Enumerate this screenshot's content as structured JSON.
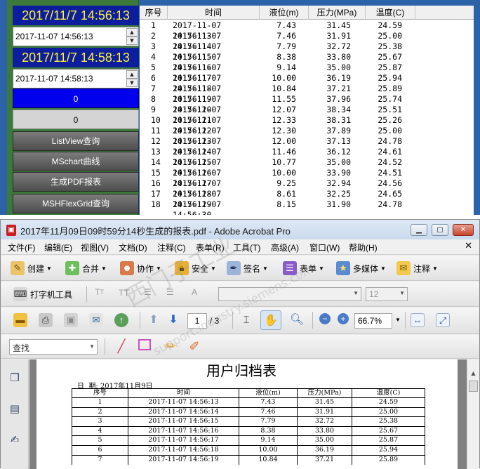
{
  "control_panel": {
    "start_time_display": "2017/11/7 14:56:13",
    "start_time_picker": "2017-11-07 14:56:13",
    "end_time_display": "2017/11/7 14:58:13",
    "end_time_picker": "2017-11-07 14:58:13",
    "counter_1": "0",
    "counter_2": "0",
    "buttons": [
      "ListView查询",
      "MSchart曲线",
      "生成PDF报表",
      "MSHFlexGrid查询"
    ]
  },
  "listview": {
    "columns": [
      "序号",
      "时间",
      "液位(m)",
      "压力(MPa)",
      "温度(C)"
    ],
    "rows": [
      [
        "1",
        "2017-11-07 14:56:13",
        "7.43",
        "31.45",
        "24.59"
      ],
      [
        "2",
        "2017-11-07 14:56:14",
        "7.46",
        "31.91",
        "25.00"
      ],
      [
        "3",
        "2017-11-07 14:56:15",
        "7.79",
        "32.72",
        "25.38"
      ],
      [
        "4",
        "2017-11-07 14:56:16",
        "8.38",
        "33.80",
        "25.67"
      ],
      [
        "5",
        "2017-11-07 14:56:17",
        "9.14",
        "35.00",
        "25.87"
      ],
      [
        "6",
        "2017-11-07 14:56:18",
        "10.00",
        "36.19",
        "25.94"
      ],
      [
        "7",
        "2017-11-07 14:56:19",
        "10.84",
        "37.21",
        "25.89"
      ],
      [
        "8",
        "2017-11-07 14:56:20",
        "11.55",
        "37.96",
        "25.74"
      ],
      [
        "9",
        "2017-11-07 14:56:21",
        "12.07",
        "38.34",
        "25.51"
      ],
      [
        "10",
        "2017-11-07 14:56:22",
        "12.33",
        "38.31",
        "25.26"
      ],
      [
        "11",
        "2017-11-07 14:56:23",
        "12.30",
        "37.89",
        "25.00"
      ],
      [
        "12",
        "2017-11-07 14:56:24",
        "12.00",
        "37.13",
        "24.78"
      ],
      [
        "13",
        "2017-11-07 14:56:25",
        "11.46",
        "36.12",
        "24.61"
      ],
      [
        "14",
        "2017-11-07 14:56:26",
        "10.77",
        "35.00",
        "24.52"
      ],
      [
        "15",
        "2017-11-07 14:56:27",
        "10.00",
        "33.90",
        "24.51"
      ],
      [
        "16",
        "2017-11-07 14:56:28",
        "9.25",
        "32.94",
        "24.56"
      ],
      [
        "17",
        "2017-11-07 14:56:29",
        "8.61",
        "32.25",
        "24.65"
      ],
      [
        "18",
        "2017-11-07 14:56:30",
        "8.15",
        "31.90",
        "24.78"
      ]
    ]
  },
  "acrobat": {
    "title": "2017年11月09日09时59分14秒生成的报表.pdf - Adobe Acrobat Pro",
    "menus": [
      "文件(F)",
      "编辑(E)",
      "视图(V)",
      "文档(D)",
      "注释(C)",
      "表单(R)",
      "工具(T)",
      "高级(A)",
      "窗口(W)",
      "帮助(H)"
    ],
    "toolbar1": [
      "创建",
      "合并",
      "协作",
      "安全",
      "签名",
      "表单",
      "多媒体",
      "注释"
    ],
    "typewriter": "打字机工具",
    "font_size": "12",
    "page_current": "1",
    "page_total": "/ 3",
    "zoom": "66.7%",
    "find_placeholder": "查找"
  },
  "pdf": {
    "title": "用户归档表",
    "date_label": "日  期:",
    "date_value": "2017年11月9日",
    "columns": [
      "序号",
      "时间",
      "液位(m)",
      "压力(MPa)",
      "温度(C)"
    ],
    "rows": [
      [
        "1",
        "2017-11-07  14:56:13",
        "7.43",
        "31.45",
        "24.59"
      ],
      [
        "2",
        "2017-11-07  14:56:14",
        "7.46",
        "31.91",
        "25.00"
      ],
      [
        "3",
        "2017-11-07  14:56:15",
        "7.79",
        "32.72",
        "25.38"
      ],
      [
        "4",
        "2017-11-07  14:56:16",
        "8.38",
        "33.80",
        "25.67"
      ],
      [
        "5",
        "2017-11-07  14:56:17",
        "9.14",
        "35.00",
        "25.87"
      ],
      [
        "6",
        "2017-11-07  14:56:18",
        "10.00",
        "36.19",
        "25.94"
      ],
      [
        "7",
        "2017-11-07  14:56:19",
        "10.84",
        "37.21",
        "25.89"
      ]
    ]
  },
  "watermark": {
    "line1": "西门子工业",
    "line2": "support.industry.siemens.com"
  }
}
